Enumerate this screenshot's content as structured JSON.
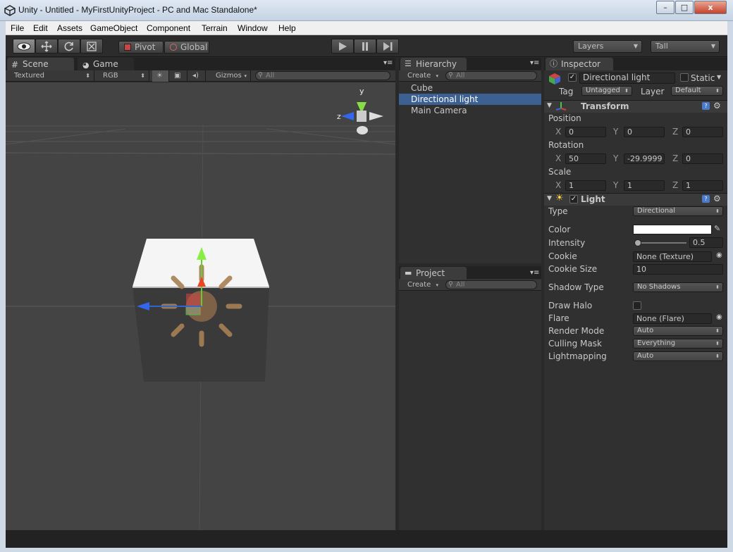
{
  "window": {
    "title": "Unity - Untitled - MyFirstUnityProject - PC and Mac Standalone*",
    "min": "–",
    "max": "□",
    "close": "x"
  },
  "menu": [
    "File",
    "Edit",
    "Assets",
    "GameObject",
    "Component",
    "Terrain",
    "Window",
    "Help"
  ],
  "toolbar": {
    "pivot": "Pivot",
    "global": "Global",
    "layers": "Layers",
    "layout": "Tall"
  },
  "scene": {
    "tab": "Scene",
    "game_tab": "Game",
    "render_mode": "Textured",
    "color_mode": "RGB",
    "gizmos": "Gizmos",
    "search_placeholder": "All"
  },
  "gizmo": {
    "y": "y",
    "z": "z"
  },
  "hierarchy": {
    "tab": "Hierarchy",
    "create": "Create",
    "search_placeholder": "All",
    "items": [
      "Cube",
      "Directional light",
      "Main Camera"
    ],
    "selected": "Directional light"
  },
  "project": {
    "tab": "Project",
    "create": "Create",
    "search_placeholder": "All"
  },
  "inspector": {
    "tab": "Inspector",
    "object_name": "Directional light",
    "static_label": "Static",
    "tag_label": "Tag",
    "tag_value": "Untagged",
    "layer_label": "Layer",
    "layer_value": "Default",
    "transform": {
      "title": "Transform",
      "position_label": "Position",
      "position": {
        "x": "0",
        "y": "0",
        "z": "0"
      },
      "rotation_label": "Rotation",
      "rotation": {
        "x": "50",
        "y": "-29.9999",
        "z": "0"
      },
      "scale_label": "Scale",
      "scale": {
        "x": "1",
        "y": "1",
        "z": "1"
      }
    },
    "light": {
      "title": "Light",
      "type_label": "Type",
      "type": "Directional",
      "color_label": "Color",
      "color": "#ffffff",
      "intensity_label": "Intensity",
      "intensity": "0.5",
      "cookie_label": "Cookie",
      "cookie": "None (Texture)",
      "cookie_size_label": "Cookie Size",
      "cookie_size": "10",
      "shadow_type_label": "Shadow Type",
      "shadow_type": "No Shadows",
      "draw_halo_label": "Draw Halo",
      "flare_label": "Flare",
      "flare": "None (Flare)",
      "render_mode_label": "Render Mode",
      "render_mode": "Auto",
      "culling_mask_label": "Culling Mask",
      "culling_mask": "Everything",
      "lightmapping_label": "Lightmapping",
      "lightmapping": "Auto"
    }
  },
  "axes": {
    "x": "X",
    "y": "Y",
    "z": "Z"
  }
}
